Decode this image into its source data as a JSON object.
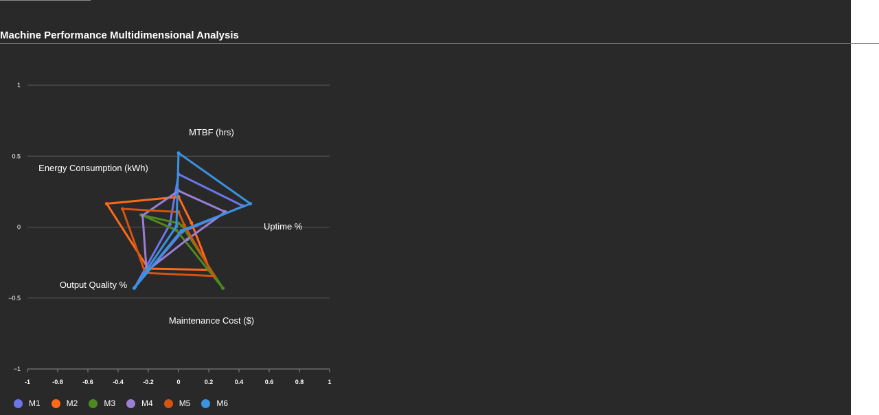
{
  "chart_data": {
    "type": "radar",
    "title": "Machine Performance Multidimensional Analysis",
    "axes": [
      "MTBF (hrs)",
      "Uptime %",
      "Maintenance Cost ($)",
      "Output Quality %",
      "Energy Consumption (kWh)"
    ],
    "x_ticks": [
      "-1",
      "-0.8",
      "-0.6",
      "-0.4",
      "-0.2",
      "0",
      "0.2",
      "0.4",
      "0.6",
      "0.8",
      "1"
    ],
    "y_ticks": [
      "1",
      "0.5",
      "0",
      "−0.5",
      "−1"
    ],
    "xlim": [
      -1,
      1
    ],
    "ylim": [
      -1,
      1
    ],
    "grid": "horizontal",
    "legend_position": "bottom-left",
    "series": [
      {
        "name": "M1",
        "color": "#6a76e8",
        "values": [
          0.7,
          0.9,
          0.08,
          0.98,
          0.12
        ]
      },
      {
        "name": "M2",
        "color": "#ff6a1a",
        "values": [
          0.4,
          0.18,
          0.7,
          0.68,
          1.0
        ]
      },
      {
        "name": "M3",
        "color": "#4e8a20",
        "values": [
          0.05,
          0.05,
          1.0,
          0.05,
          0.52
        ]
      },
      {
        "name": "M4",
        "color": "#9b7fd4",
        "values": [
          0.48,
          0.65,
          0.2,
          0.72,
          0.5
        ]
      },
      {
        "name": "M5",
        "color": "#d35413",
        "values": [
          0.2,
          0.08,
          0.8,
          0.75,
          0.78
        ]
      },
      {
        "name": "M6",
        "color": "#3a92e0",
        "values": [
          0.98,
          1.0,
          0.06,
          1.0,
          0.03
        ]
      }
    ]
  }
}
